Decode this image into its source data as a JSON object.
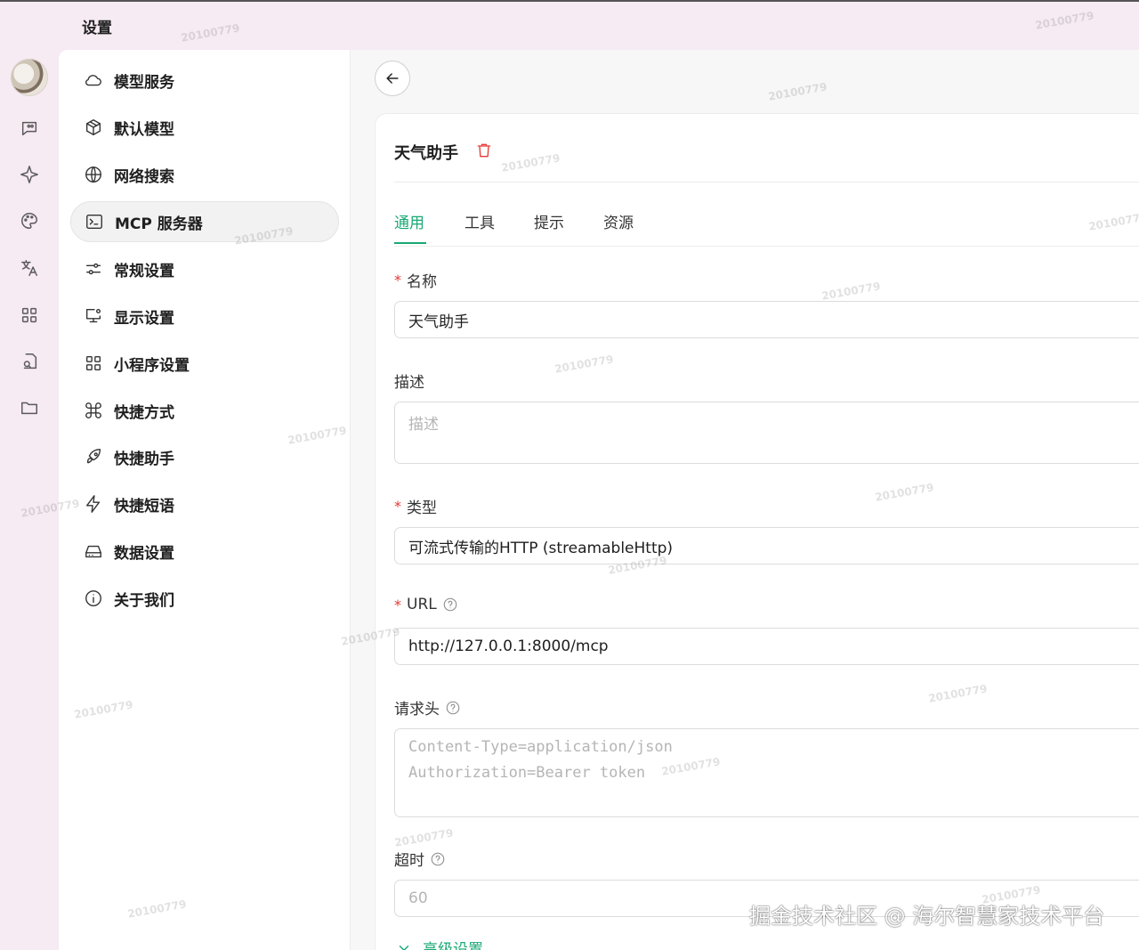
{
  "app": {
    "title": "设置"
  },
  "rail": {
    "items": [
      {
        "icon": "chat-icon"
      },
      {
        "icon": "sparkle-icon"
      },
      {
        "icon": "palette-icon"
      },
      {
        "icon": "translate-icon"
      },
      {
        "icon": "apps-grid-icon"
      },
      {
        "icon": "document-search-icon"
      },
      {
        "icon": "folder-icon"
      }
    ]
  },
  "menu": {
    "active_index": 3,
    "items": [
      {
        "label": "模型服务",
        "icon": "cloud-icon"
      },
      {
        "label": "默认模型",
        "icon": "cube-icon"
      },
      {
        "label": "网络搜索",
        "icon": "globe-icon"
      },
      {
        "label": "MCP 服务器",
        "icon": "terminal-icon"
      },
      {
        "label": "常规设置",
        "icon": "sliders-icon"
      },
      {
        "label": "显示设置",
        "icon": "monitor-settings-icon"
      },
      {
        "label": "小程序设置",
        "icon": "grid-icon"
      },
      {
        "label": "快捷方式",
        "icon": "command-icon"
      },
      {
        "label": "快捷助手",
        "icon": "rocket-icon"
      },
      {
        "label": "快捷短语",
        "icon": "zap-icon"
      },
      {
        "label": "数据设置",
        "icon": "hard-drive-icon"
      },
      {
        "label": "关于我们",
        "icon": "info-icon"
      }
    ]
  },
  "server": {
    "name": "天气助手",
    "tabs": [
      {
        "label": "通用",
        "active": true
      },
      {
        "label": "工具",
        "active": false
      },
      {
        "label": "提示",
        "active": false
      },
      {
        "label": "资源",
        "active": false
      }
    ],
    "form": {
      "name_label": "名称",
      "name_value": "天气助手",
      "description_label": "描述",
      "description_placeholder": "描述",
      "type_label": "类型",
      "type_value": "可流式传输的HTTP (streamableHttp)",
      "url_label": "URL",
      "url_value": "http://127.0.0.1:8000/mcp",
      "headers_label": "请求头",
      "headers_placeholder": "Content-Type=application/json\nAuthorization=Bearer token",
      "timeout_label": "超时",
      "timeout_placeholder": "60",
      "advanced_label": "高级设置"
    }
  },
  "accent_color": "#19a974",
  "danger_color": "#e53935",
  "watermark": "20100779",
  "credit": "掘金技术社区 @ 海尔智慧家技术平台"
}
